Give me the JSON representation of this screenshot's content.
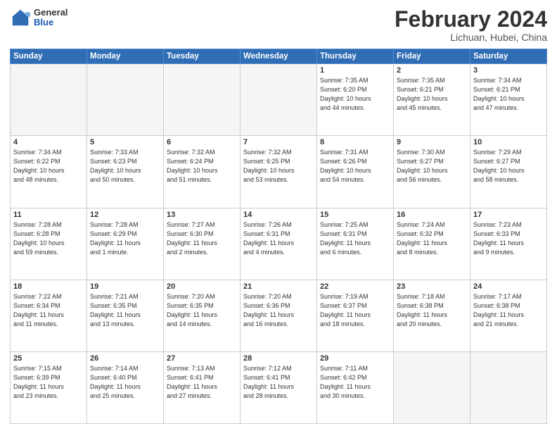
{
  "header": {
    "logo": {
      "general": "General",
      "blue": "Blue"
    },
    "title": "February 2024",
    "location": "Lichuan, Hubei, China"
  },
  "days_of_week": [
    "Sunday",
    "Monday",
    "Tuesday",
    "Wednesday",
    "Thursday",
    "Friday",
    "Saturday"
  ],
  "weeks": [
    [
      {
        "day": "",
        "info": ""
      },
      {
        "day": "",
        "info": ""
      },
      {
        "day": "",
        "info": ""
      },
      {
        "day": "",
        "info": ""
      },
      {
        "day": "1",
        "info": "Sunrise: 7:35 AM\nSunset: 6:20 PM\nDaylight: 10 hours\nand 44 minutes."
      },
      {
        "day": "2",
        "info": "Sunrise: 7:35 AM\nSunset: 6:21 PM\nDaylight: 10 hours\nand 45 minutes."
      },
      {
        "day": "3",
        "info": "Sunrise: 7:34 AM\nSunset: 6:21 PM\nDaylight: 10 hours\nand 47 minutes."
      }
    ],
    [
      {
        "day": "4",
        "info": "Sunrise: 7:34 AM\nSunset: 6:22 PM\nDaylight: 10 hours\nand 48 minutes."
      },
      {
        "day": "5",
        "info": "Sunrise: 7:33 AM\nSunset: 6:23 PM\nDaylight: 10 hours\nand 50 minutes."
      },
      {
        "day": "6",
        "info": "Sunrise: 7:32 AM\nSunset: 6:24 PM\nDaylight: 10 hours\nand 51 minutes."
      },
      {
        "day": "7",
        "info": "Sunrise: 7:32 AM\nSunset: 6:25 PM\nDaylight: 10 hours\nand 53 minutes."
      },
      {
        "day": "8",
        "info": "Sunrise: 7:31 AM\nSunset: 6:26 PM\nDaylight: 10 hours\nand 54 minutes."
      },
      {
        "day": "9",
        "info": "Sunrise: 7:30 AM\nSunset: 6:27 PM\nDaylight: 10 hours\nand 56 minutes."
      },
      {
        "day": "10",
        "info": "Sunrise: 7:29 AM\nSunset: 6:27 PM\nDaylight: 10 hours\nand 58 minutes."
      }
    ],
    [
      {
        "day": "11",
        "info": "Sunrise: 7:28 AM\nSunset: 6:28 PM\nDaylight: 10 hours\nand 59 minutes."
      },
      {
        "day": "12",
        "info": "Sunrise: 7:28 AM\nSunset: 6:29 PM\nDaylight: 11 hours\nand 1 minute."
      },
      {
        "day": "13",
        "info": "Sunrise: 7:27 AM\nSunset: 6:30 PM\nDaylight: 11 hours\nand 2 minutes."
      },
      {
        "day": "14",
        "info": "Sunrise: 7:26 AM\nSunset: 6:31 PM\nDaylight: 11 hours\nand 4 minutes."
      },
      {
        "day": "15",
        "info": "Sunrise: 7:25 AM\nSunset: 6:31 PM\nDaylight: 11 hours\nand 6 minutes."
      },
      {
        "day": "16",
        "info": "Sunrise: 7:24 AM\nSunset: 6:32 PM\nDaylight: 11 hours\nand 8 minutes."
      },
      {
        "day": "17",
        "info": "Sunrise: 7:23 AM\nSunset: 6:33 PM\nDaylight: 11 hours\nand 9 minutes."
      }
    ],
    [
      {
        "day": "18",
        "info": "Sunrise: 7:22 AM\nSunset: 6:34 PM\nDaylight: 11 hours\nand 11 minutes."
      },
      {
        "day": "19",
        "info": "Sunrise: 7:21 AM\nSunset: 6:35 PM\nDaylight: 11 hours\nand 13 minutes."
      },
      {
        "day": "20",
        "info": "Sunrise: 7:20 AM\nSunset: 6:35 PM\nDaylight: 11 hours\nand 14 minutes."
      },
      {
        "day": "21",
        "info": "Sunrise: 7:20 AM\nSunset: 6:36 PM\nDaylight: 11 hours\nand 16 minutes."
      },
      {
        "day": "22",
        "info": "Sunrise: 7:19 AM\nSunset: 6:37 PM\nDaylight: 11 hours\nand 18 minutes."
      },
      {
        "day": "23",
        "info": "Sunrise: 7:18 AM\nSunset: 6:38 PM\nDaylight: 11 hours\nand 20 minutes."
      },
      {
        "day": "24",
        "info": "Sunrise: 7:17 AM\nSunset: 6:38 PM\nDaylight: 11 hours\nand 21 minutes."
      }
    ],
    [
      {
        "day": "25",
        "info": "Sunrise: 7:15 AM\nSunset: 6:39 PM\nDaylight: 11 hours\nand 23 minutes."
      },
      {
        "day": "26",
        "info": "Sunrise: 7:14 AM\nSunset: 6:40 PM\nDaylight: 11 hours\nand 25 minutes."
      },
      {
        "day": "27",
        "info": "Sunrise: 7:13 AM\nSunset: 6:41 PM\nDaylight: 11 hours\nand 27 minutes."
      },
      {
        "day": "28",
        "info": "Sunrise: 7:12 AM\nSunset: 6:41 PM\nDaylight: 11 hours\nand 28 minutes."
      },
      {
        "day": "29",
        "info": "Sunrise: 7:11 AM\nSunset: 6:42 PM\nDaylight: 11 hours\nand 30 minutes."
      },
      {
        "day": "",
        "info": ""
      },
      {
        "day": "",
        "info": ""
      }
    ]
  ]
}
